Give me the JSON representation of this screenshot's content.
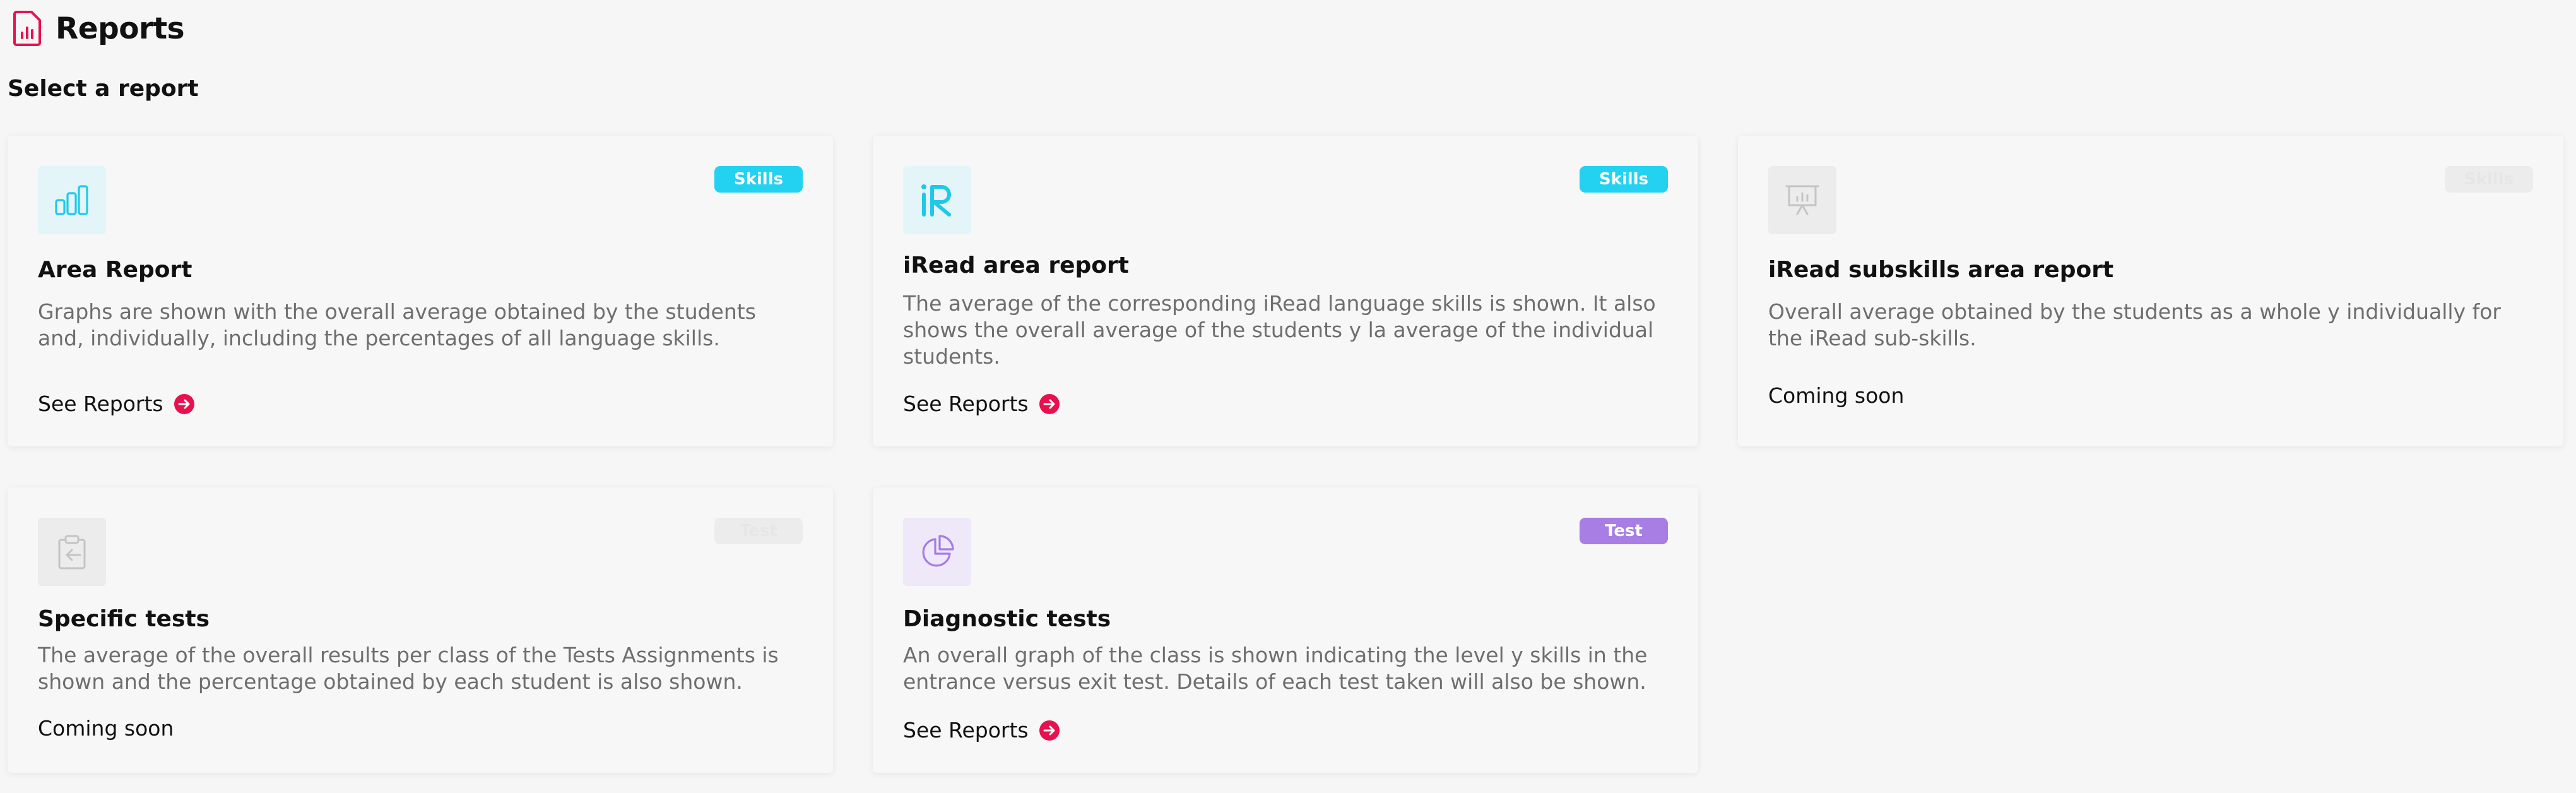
{
  "header": {
    "title": "Reports",
    "icon": "report-file-icon"
  },
  "subtitle": "Select a report",
  "colors": {
    "accent": "#e8114f",
    "skills_badge": "#22d2f0",
    "test_badge": "#a87de4",
    "disabled_badge": "#ececec",
    "cyan_icon": "#1fc8ea",
    "purple_icon": "#a57ce0"
  },
  "cards": [
    {
      "badge": "Skills",
      "icon": "bar-chart-icon",
      "title": "Area Report",
      "description": "Graphs are shown with the overall average obtained by the students and, individually, including the percentages of all language skills.",
      "action": "See Reports"
    },
    {
      "badge": "Skills",
      "icon": "iread-logo-icon",
      "title": "iRead area report",
      "description": "The average of the corresponding iRead language skills is shown. It also shows the overall average of the students y la average of the individual students.",
      "action": "See Reports"
    },
    {
      "badge": "Skills",
      "icon": "presentation-board-icon",
      "title": "iRead subskills area report",
      "description": "Overall average obtained by the students as a whole y individually for the iRead sub-skills.",
      "status": "Coming soon"
    },
    {
      "badge": "Test",
      "icon": "clipboard-arrow-icon",
      "title": "Specific tests",
      "description": "The average of the overall results per class of the Tests Assignments is shown and the percentage obtained by each student is also shown.",
      "status": "Coming soon"
    },
    {
      "badge": "Test",
      "icon": "pie-chart-icon",
      "title": "Diagnostic tests",
      "description": "An overall graph of the class is shown indicating the level y skills in the entrance versus exit test. Details of each test taken will also be shown.",
      "action": "See Reports"
    }
  ]
}
